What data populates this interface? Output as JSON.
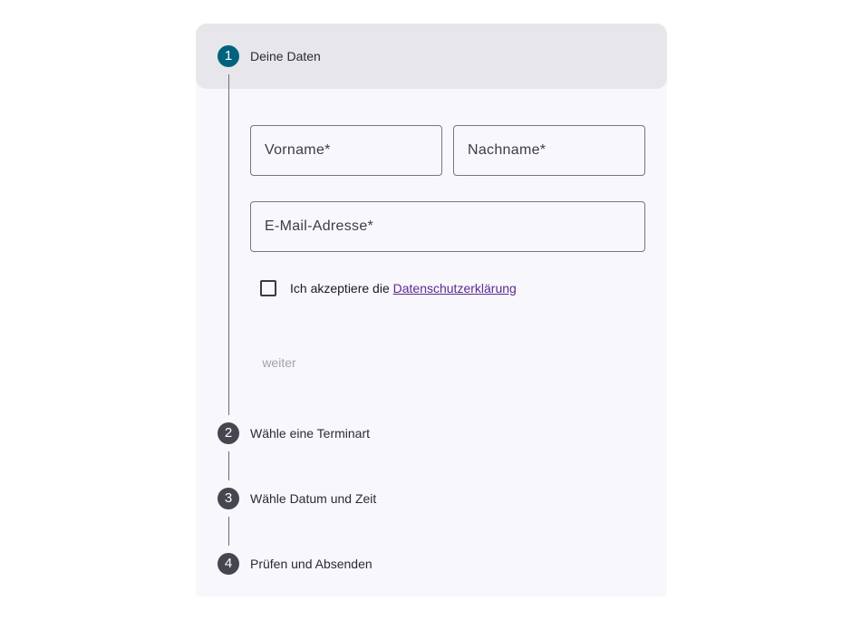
{
  "steps": [
    {
      "number": "1",
      "label": "Deine Daten"
    },
    {
      "number": "2",
      "label": "Wähle eine Terminart"
    },
    {
      "number": "3",
      "label": "Wähle Datum und Zeit"
    },
    {
      "number": "4",
      "label": "Prüfen und Absenden"
    }
  ],
  "form": {
    "firstname_label": "Vorname*",
    "lastname_label": "Nachname*",
    "email_label": "E-Mail-Adresse*",
    "privacy_text": "Ich akzeptiere die ",
    "privacy_link": "Datenschutzerklärung",
    "next_button": "weiter"
  },
  "colors": {
    "active_step": "#00637d",
    "inactive_step": "#45464f",
    "active_header_bg": "#e7e6ea",
    "panel_bg": "#f8f7fc",
    "link": "#5d2a8e"
  }
}
